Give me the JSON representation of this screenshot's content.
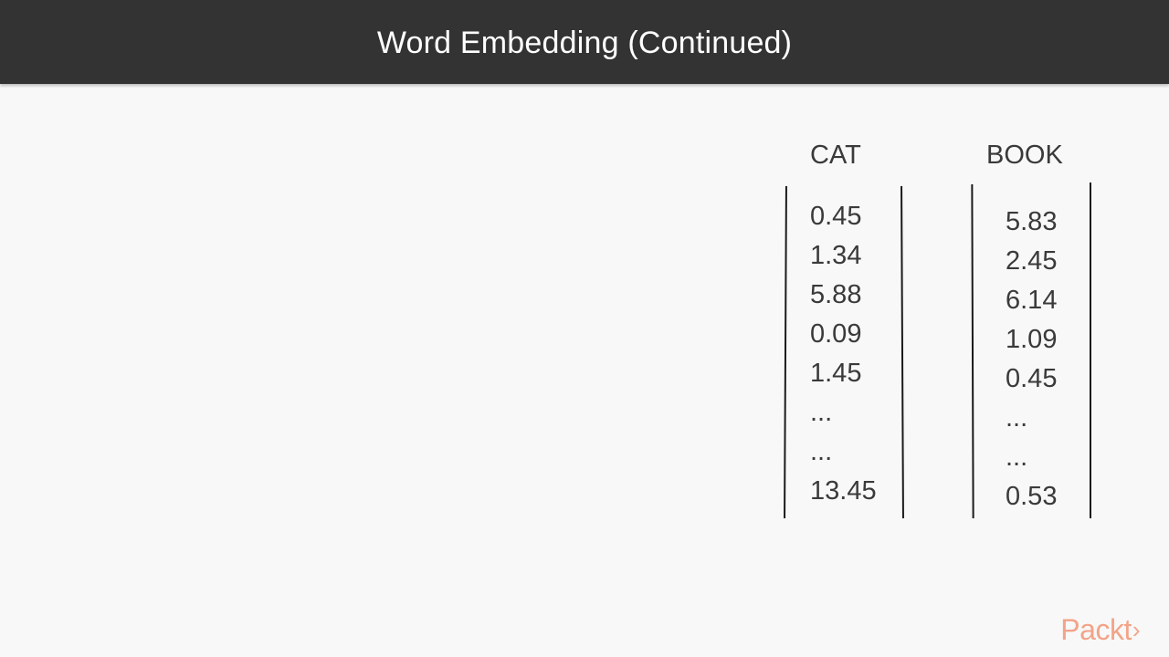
{
  "slide": {
    "title": "Word Embedding (Continued)"
  },
  "vectors": [
    {
      "label": "CAT",
      "values": [
        "0.45",
        "1.34",
        "5.88",
        "0.09",
        "1.45",
        "...",
        "...",
        "13.45"
      ]
    },
    {
      "label": "BOOK",
      "values": [
        "5.83",
        "2.45",
        "6.14",
        "1.09",
        "0.45",
        "...",
        "...",
        "0.53"
      ]
    }
  ],
  "logo": {
    "text": "Packt",
    "arrow": "›",
    "color": "#f2a488"
  },
  "colors": {
    "title_bar": "#333333",
    "background": "#f8f8f8",
    "text": "#3a3a3a"
  }
}
